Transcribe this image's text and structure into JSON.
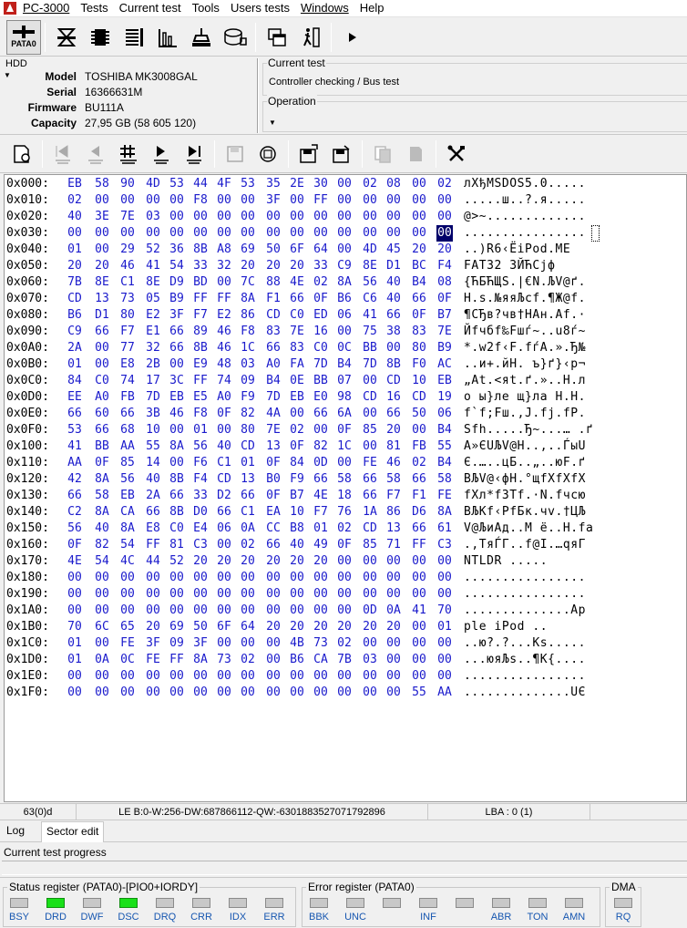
{
  "menu": [
    "PC-3000",
    "Tests",
    "Current test",
    "Tools",
    "Users tests",
    "Windows",
    "Help"
  ],
  "toolbar": {
    "pata_label": "PATA0"
  },
  "hdd": {
    "group_label": "HDD",
    "fields": [
      {
        "key": "Model",
        "value": "TOSHIBA MK3008GAL"
      },
      {
        "key": "Serial",
        "value": "16366631M"
      },
      {
        "key": "Firmware",
        "value": "BU111A"
      },
      {
        "key": "Capacity",
        "value": "27,95 GB (58 605 120)"
      }
    ]
  },
  "current_test": {
    "label": "Current test",
    "value": "Controller checking / Bus test"
  },
  "operation": {
    "label": "Operation",
    "value": ""
  },
  "hex": {
    "rows": [
      {
        "offset": "0x000:",
        "bytes": [
          "EB",
          "58",
          "90",
          "4D",
          "53",
          "44",
          "4F",
          "53",
          "35",
          "2E",
          "30",
          "00",
          "02",
          "08",
          "00",
          "02"
        ],
        "ascii": "лXђMSDOS5.0....."
      },
      {
        "offset": "0x010:",
        "bytes": [
          "02",
          "00",
          "00",
          "00",
          "00",
          "F8",
          "00",
          "00",
          "3F",
          "00",
          "FF",
          "00",
          "00",
          "00",
          "00",
          "00"
        ],
        "ascii": ".....ш..?.я....."
      },
      {
        "offset": "0x020:",
        "bytes": [
          "40",
          "3E",
          "7E",
          "03",
          "00",
          "00",
          "00",
          "00",
          "00",
          "00",
          "00",
          "00",
          "00",
          "00",
          "00",
          "00"
        ],
        "ascii": "@>~............."
      },
      {
        "offset": "0x030:",
        "bytes": [
          "00",
          "00",
          "00",
          "00",
          "00",
          "00",
          "00",
          "00",
          "00",
          "00",
          "00",
          "00",
          "00",
          "00",
          "00",
          "00"
        ],
        "ascii": "................"
      },
      {
        "offset": "0x040:",
        "bytes": [
          "01",
          "00",
          "29",
          "52",
          "36",
          "8B",
          "A8",
          "69",
          "50",
          "6F",
          "64",
          "00",
          "4D",
          "45",
          "20",
          "20"
        ],
        "ascii": "..)R6‹ЁiPod.ME  "
      },
      {
        "offset": "0x050:",
        "bytes": [
          "20",
          "20",
          "46",
          "41",
          "54",
          "33",
          "32",
          "20",
          "20",
          "20",
          "33",
          "C9",
          "8E",
          "D1",
          "BC",
          "F4"
        ],
        "ascii": "  FAT32   3ЙЋСјф"
      },
      {
        "offset": "0x060:",
        "bytes": [
          "7B",
          "8E",
          "C1",
          "8E",
          "D9",
          "BD",
          "00",
          "7C",
          "88",
          "4E",
          "02",
          "8A",
          "56",
          "40",
          "B4",
          "08"
        ],
        "ascii": "{ЋБЋЩЅ.|€N.ЉV@ґ."
      },
      {
        "offset": "0x070:",
        "bytes": [
          "CD",
          "13",
          "73",
          "05",
          "B9",
          "FF",
          "FF",
          "8A",
          "F1",
          "66",
          "0F",
          "B6",
          "C6",
          "40",
          "66",
          "0F"
        ],
        "ascii": "Н.s.№яяЉсf.¶Ж@f."
      },
      {
        "offset": "0x080:",
        "bytes": [
          "B6",
          "D1",
          "80",
          "E2",
          "3F",
          "F7",
          "E2",
          "86",
          "CD",
          "C0",
          "ED",
          "06",
          "41",
          "66",
          "0F",
          "B7"
        ],
        "ascii": "¶СЂв?чв†НАн.Af.·"
      },
      {
        "offset": "0x090:",
        "bytes": [
          "C9",
          "66",
          "F7",
          "E1",
          "66",
          "89",
          "46",
          "F8",
          "83",
          "7E",
          "16",
          "00",
          "75",
          "38",
          "83",
          "7E"
        ],
        "ascii": "Йfчбf‰Fшѓ~..u8ѓ~"
      },
      {
        "offset": "0x0A0:",
        "bytes": [
          "2A",
          "00",
          "77",
          "32",
          "66",
          "8B",
          "46",
          "1C",
          "66",
          "83",
          "C0",
          "0C",
          "BB",
          "00",
          "80",
          "B9"
        ],
        "ascii": "*.w2f‹F.fѓА.».Ђ№"
      },
      {
        "offset": "0x0B0:",
        "bytes": [
          "01",
          "00",
          "E8",
          "2B",
          "00",
          "E9",
          "48",
          "03",
          "A0",
          "FA",
          "7D",
          "B4",
          "7D",
          "8B",
          "F0",
          "AC"
        ],
        "ascii": "..и+.йH. ъ}ґ}‹р¬"
      },
      {
        "offset": "0x0C0:",
        "bytes": [
          "84",
          "C0",
          "74",
          "17",
          "3C",
          "FF",
          "74",
          "09",
          "B4",
          "0E",
          "BB",
          "07",
          "00",
          "CD",
          "10",
          "EB"
        ],
        "ascii": "„Аt.<яt.ґ.»..Н.л"
      },
      {
        "offset": "0x0D0:",
        "bytes": [
          "EE",
          "A0",
          "FB",
          "7D",
          "EB",
          "E5",
          "A0",
          "F9",
          "7D",
          "EB",
          "E0",
          "98",
          "CD",
          "16",
          "CD",
          "19"
        ],
        "ascii": "о ы}ле щ}ла Н.Н."
      },
      {
        "offset": "0x0E0:",
        "bytes": [
          "66",
          "60",
          "66",
          "3B",
          "46",
          "F8",
          "0F",
          "82",
          "4A",
          "00",
          "66",
          "6A",
          "00",
          "66",
          "50",
          "06"
        ],
        "ascii": "f`f;Fш.‚J.fj.fP."
      },
      {
        "offset": "0x0F0:",
        "bytes": [
          "53",
          "66",
          "68",
          "10",
          "00",
          "01",
          "00",
          "80",
          "7E",
          "02",
          "00",
          "0F",
          "85",
          "20",
          "00",
          "B4"
        ],
        "ascii": "Sfh.....Ђ~...… .ґ"
      },
      {
        "offset": "0x100:",
        "bytes": [
          "41",
          "BB",
          "AA",
          "55",
          "8A",
          "56",
          "40",
          "CD",
          "13",
          "0F",
          "82",
          "1C",
          "00",
          "81",
          "FB",
          "55"
        ],
        "ascii": "A»ЄUЉV@Н..‚..ЃыU"
      },
      {
        "offset": "0x110:",
        "bytes": [
          "AA",
          "0F",
          "85",
          "14",
          "00",
          "F6",
          "C1",
          "01",
          "0F",
          "84",
          "0D",
          "00",
          "FE",
          "46",
          "02",
          "B4"
        ],
        "ascii": "Є.…..цБ..„..юF.ґ"
      },
      {
        "offset": "0x120:",
        "bytes": [
          "42",
          "8A",
          "56",
          "40",
          "8B",
          "F4",
          "CD",
          "13",
          "B0",
          "F9",
          "66",
          "58",
          "66",
          "58",
          "66",
          "58"
        ],
        "ascii": "BЉV@‹фН.°щfXfXfX"
      },
      {
        "offset": "0x130:",
        "bytes": [
          "66",
          "58",
          "EB",
          "2A",
          "66",
          "33",
          "D2",
          "66",
          "0F",
          "B7",
          "4E",
          "18",
          "66",
          "F7",
          "F1",
          "FE"
        ],
        "ascii": "fXл*f3Тf.·N.fчсю"
      },
      {
        "offset": "0x140:",
        "bytes": [
          "C2",
          "8A",
          "CA",
          "66",
          "8B",
          "D0",
          "66",
          "C1",
          "EA",
          "10",
          "F7",
          "76",
          "1A",
          "86",
          "D6",
          "8A"
        ],
        "ascii": "ВЉКf‹РfБк.чv.†ЦЉ"
      },
      {
        "offset": "0x150:",
        "bytes": [
          "56",
          "40",
          "8A",
          "E8",
          "C0",
          "E4",
          "06",
          "0A",
          "CC",
          "B8",
          "01",
          "02",
          "CD",
          "13",
          "66",
          "61"
        ],
        "ascii": "V@ЉиАд..М ё..Н.fa"
      },
      {
        "offset": "0x160:",
        "bytes": [
          "0F",
          "82",
          "54",
          "FF",
          "81",
          "C3",
          "00",
          "02",
          "66",
          "40",
          "49",
          "0F",
          "85",
          "71",
          "FF",
          "C3"
        ],
        "ascii": ".‚TяЃГ..f@I.…qяГ"
      },
      {
        "offset": "0x170:",
        "bytes": [
          "4E",
          "54",
          "4C",
          "44",
          "52",
          "20",
          "20",
          "20",
          "20",
          "20",
          "20",
          "00",
          "00",
          "00",
          "00",
          "00"
        ],
        "ascii": "NTLDR      ....."
      },
      {
        "offset": "0x180:",
        "bytes": [
          "00",
          "00",
          "00",
          "00",
          "00",
          "00",
          "00",
          "00",
          "00",
          "00",
          "00",
          "00",
          "00",
          "00",
          "00",
          "00"
        ],
        "ascii": "................"
      },
      {
        "offset": "0x190:",
        "bytes": [
          "00",
          "00",
          "00",
          "00",
          "00",
          "00",
          "00",
          "00",
          "00",
          "00",
          "00",
          "00",
          "00",
          "00",
          "00",
          "00"
        ],
        "ascii": "................"
      },
      {
        "offset": "0x1A0:",
        "bytes": [
          "00",
          "00",
          "00",
          "00",
          "00",
          "00",
          "00",
          "00",
          "00",
          "00",
          "00",
          "00",
          "0D",
          "0A",
          "41",
          "70"
        ],
        "ascii": "..............Ap"
      },
      {
        "offset": "0x1B0:",
        "bytes": [
          "70",
          "6C",
          "65",
          "20",
          "69",
          "50",
          "6F",
          "64",
          "20",
          "20",
          "20",
          "20",
          "20",
          "20",
          "00",
          "01"
        ],
        "ascii": "ple iPod      .."
      },
      {
        "offset": "0x1C0:",
        "bytes": [
          "01",
          "00",
          "FE",
          "3F",
          "09",
          "3F",
          "00",
          "00",
          "00",
          "4B",
          "73",
          "02",
          "00",
          "00",
          "00",
          "00"
        ],
        "ascii": "..ю?.?...Ks....."
      },
      {
        "offset": "0x1D0:",
        "bytes": [
          "01",
          "0A",
          "0C",
          "FE",
          "FF",
          "8A",
          "73",
          "02",
          "00",
          "B6",
          "CA",
          "7B",
          "03",
          "00",
          "00",
          "00"
        ],
        "ascii": "...юяЉs..¶К{...."
      },
      {
        "offset": "0x1E0:",
        "bytes": [
          "00",
          "00",
          "00",
          "00",
          "00",
          "00",
          "00",
          "00",
          "00",
          "00",
          "00",
          "00",
          "00",
          "00",
          "00",
          "00"
        ],
        "ascii": "................"
      },
      {
        "offset": "0x1F0:",
        "bytes": [
          "00",
          "00",
          "00",
          "00",
          "00",
          "00",
          "00",
          "00",
          "00",
          "00",
          "00",
          "00",
          "00",
          "00",
          "55",
          "AA"
        ],
        "ascii": "..............UЄ"
      }
    ],
    "cursor": {
      "row": 3,
      "col": 15
    }
  },
  "statusbar": {
    "position": "63(0)d",
    "le": "LE B:0-W:256-DW:687866112-QW:-6301883527071792896",
    "lba": "LBA : 0 (1)"
  },
  "tabs": [
    "Log",
    "Sector edit"
  ],
  "active_tab": "Sector edit",
  "progress": {
    "label": "Current test progress",
    "value": 0
  },
  "status_register": {
    "label": "Status register (PATA0)-[PIO0+IORDY]",
    "bits": [
      {
        "name": "BSY",
        "on": false
      },
      {
        "name": "DRD",
        "on": true
      },
      {
        "name": "DWF",
        "on": false
      },
      {
        "name": "DSC",
        "on": true
      },
      {
        "name": "DRQ",
        "on": false
      },
      {
        "name": "CRR",
        "on": false
      },
      {
        "name": "IDX",
        "on": false
      },
      {
        "name": "ERR",
        "on": false
      }
    ]
  },
  "error_register": {
    "label": "Error register (PATA0)",
    "bits": [
      {
        "name": "BBK",
        "on": false
      },
      {
        "name": "UNC",
        "on": false
      },
      {
        "name": "",
        "on": false
      },
      {
        "name": "INF",
        "on": false
      },
      {
        "name": "",
        "on": false
      },
      {
        "name": "ABR",
        "on": false
      },
      {
        "name": "TON",
        "on": false
      },
      {
        "name": "AMN",
        "on": false
      }
    ]
  },
  "dma": {
    "label": "DMA",
    "bits": [
      {
        "name": "RQ",
        "on": false
      }
    ]
  },
  "colors": {
    "hex_bytes": "#1a1acc",
    "led_on": "#19e019",
    "led_off": "#c8c8c8",
    "cursor_bg": "#00006a"
  }
}
